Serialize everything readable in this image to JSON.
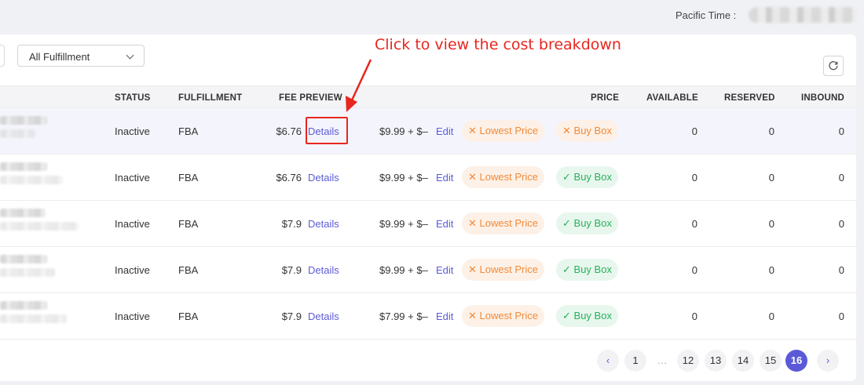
{
  "header": {
    "pacific_time_label": "Pacific Time :"
  },
  "filters": {
    "fulfillment_select": "All Fulfillment"
  },
  "table": {
    "columns": {
      "status": "STATUS",
      "fulfillment": "FULFILLMENT",
      "fee_preview": "FEE PREVIEW",
      "price": "PRICE",
      "available": "AVAILABLE",
      "reserved": "RESERVED",
      "inbound": "INBOUND"
    },
    "rows": [
      {
        "status": "Inactive",
        "fulfillment": "FBA",
        "fee": "$6.76",
        "details": "Details",
        "price": "$9.99 + $–",
        "edit": "Edit",
        "lowest_price": "Lowest Price",
        "lowest_icon": "✕",
        "buy_box": "Buy Box",
        "buy_box_icon": "✕",
        "buy_box_status": "fail",
        "available": "0",
        "reserved": "0",
        "inbound": "0"
      },
      {
        "status": "Inactive",
        "fulfillment": "FBA",
        "fee": "$6.76",
        "details": "Details",
        "price": "$9.99 + $–",
        "edit": "Edit",
        "lowest_price": "Lowest Price",
        "lowest_icon": "✕",
        "buy_box": "Buy Box",
        "buy_box_icon": "✓",
        "buy_box_status": "ok",
        "available": "0",
        "reserved": "0",
        "inbound": "0"
      },
      {
        "status": "Inactive",
        "fulfillment": "FBA",
        "fee": "$7.9",
        "details": "Details",
        "price": "$9.99 + $–",
        "edit": "Edit",
        "lowest_price": "Lowest Price",
        "lowest_icon": "✕",
        "buy_box": "Buy Box",
        "buy_box_icon": "✓",
        "buy_box_status": "ok",
        "available": "0",
        "reserved": "0",
        "inbound": "0"
      },
      {
        "status": "Inactive",
        "fulfillment": "FBA",
        "fee": "$7.9",
        "details": "Details",
        "price": "$9.99 + $–",
        "edit": "Edit",
        "lowest_price": "Lowest Price",
        "lowest_icon": "✕",
        "buy_box": "Buy Box",
        "buy_box_icon": "✓",
        "buy_box_status": "ok",
        "available": "0",
        "reserved": "0",
        "inbound": "0"
      },
      {
        "status": "Inactive",
        "fulfillment": "FBA",
        "fee": "$7.9",
        "details": "Details",
        "price": "$7.99 + $–",
        "edit": "Edit",
        "lowest_price": "Lowest Price",
        "lowest_icon": "✕",
        "buy_box": "Buy Box",
        "buy_box_icon": "✓",
        "buy_box_status": "ok",
        "available": "0",
        "reserved": "0",
        "inbound": "0"
      }
    ]
  },
  "pagination": {
    "prev_icon": "‹",
    "next_icon": "›",
    "pages": [
      "1",
      "…",
      "12",
      "13",
      "14",
      "15",
      "16"
    ],
    "current": "16"
  },
  "annotation": {
    "text": "Click to view the cost breakdown",
    "color": "#e8261f"
  },
  "colors": {
    "accent": "#5a5ad8",
    "link": "#5c5cd6",
    "chip_orange": "#f08a3a",
    "chip_green": "#27b05a"
  }
}
